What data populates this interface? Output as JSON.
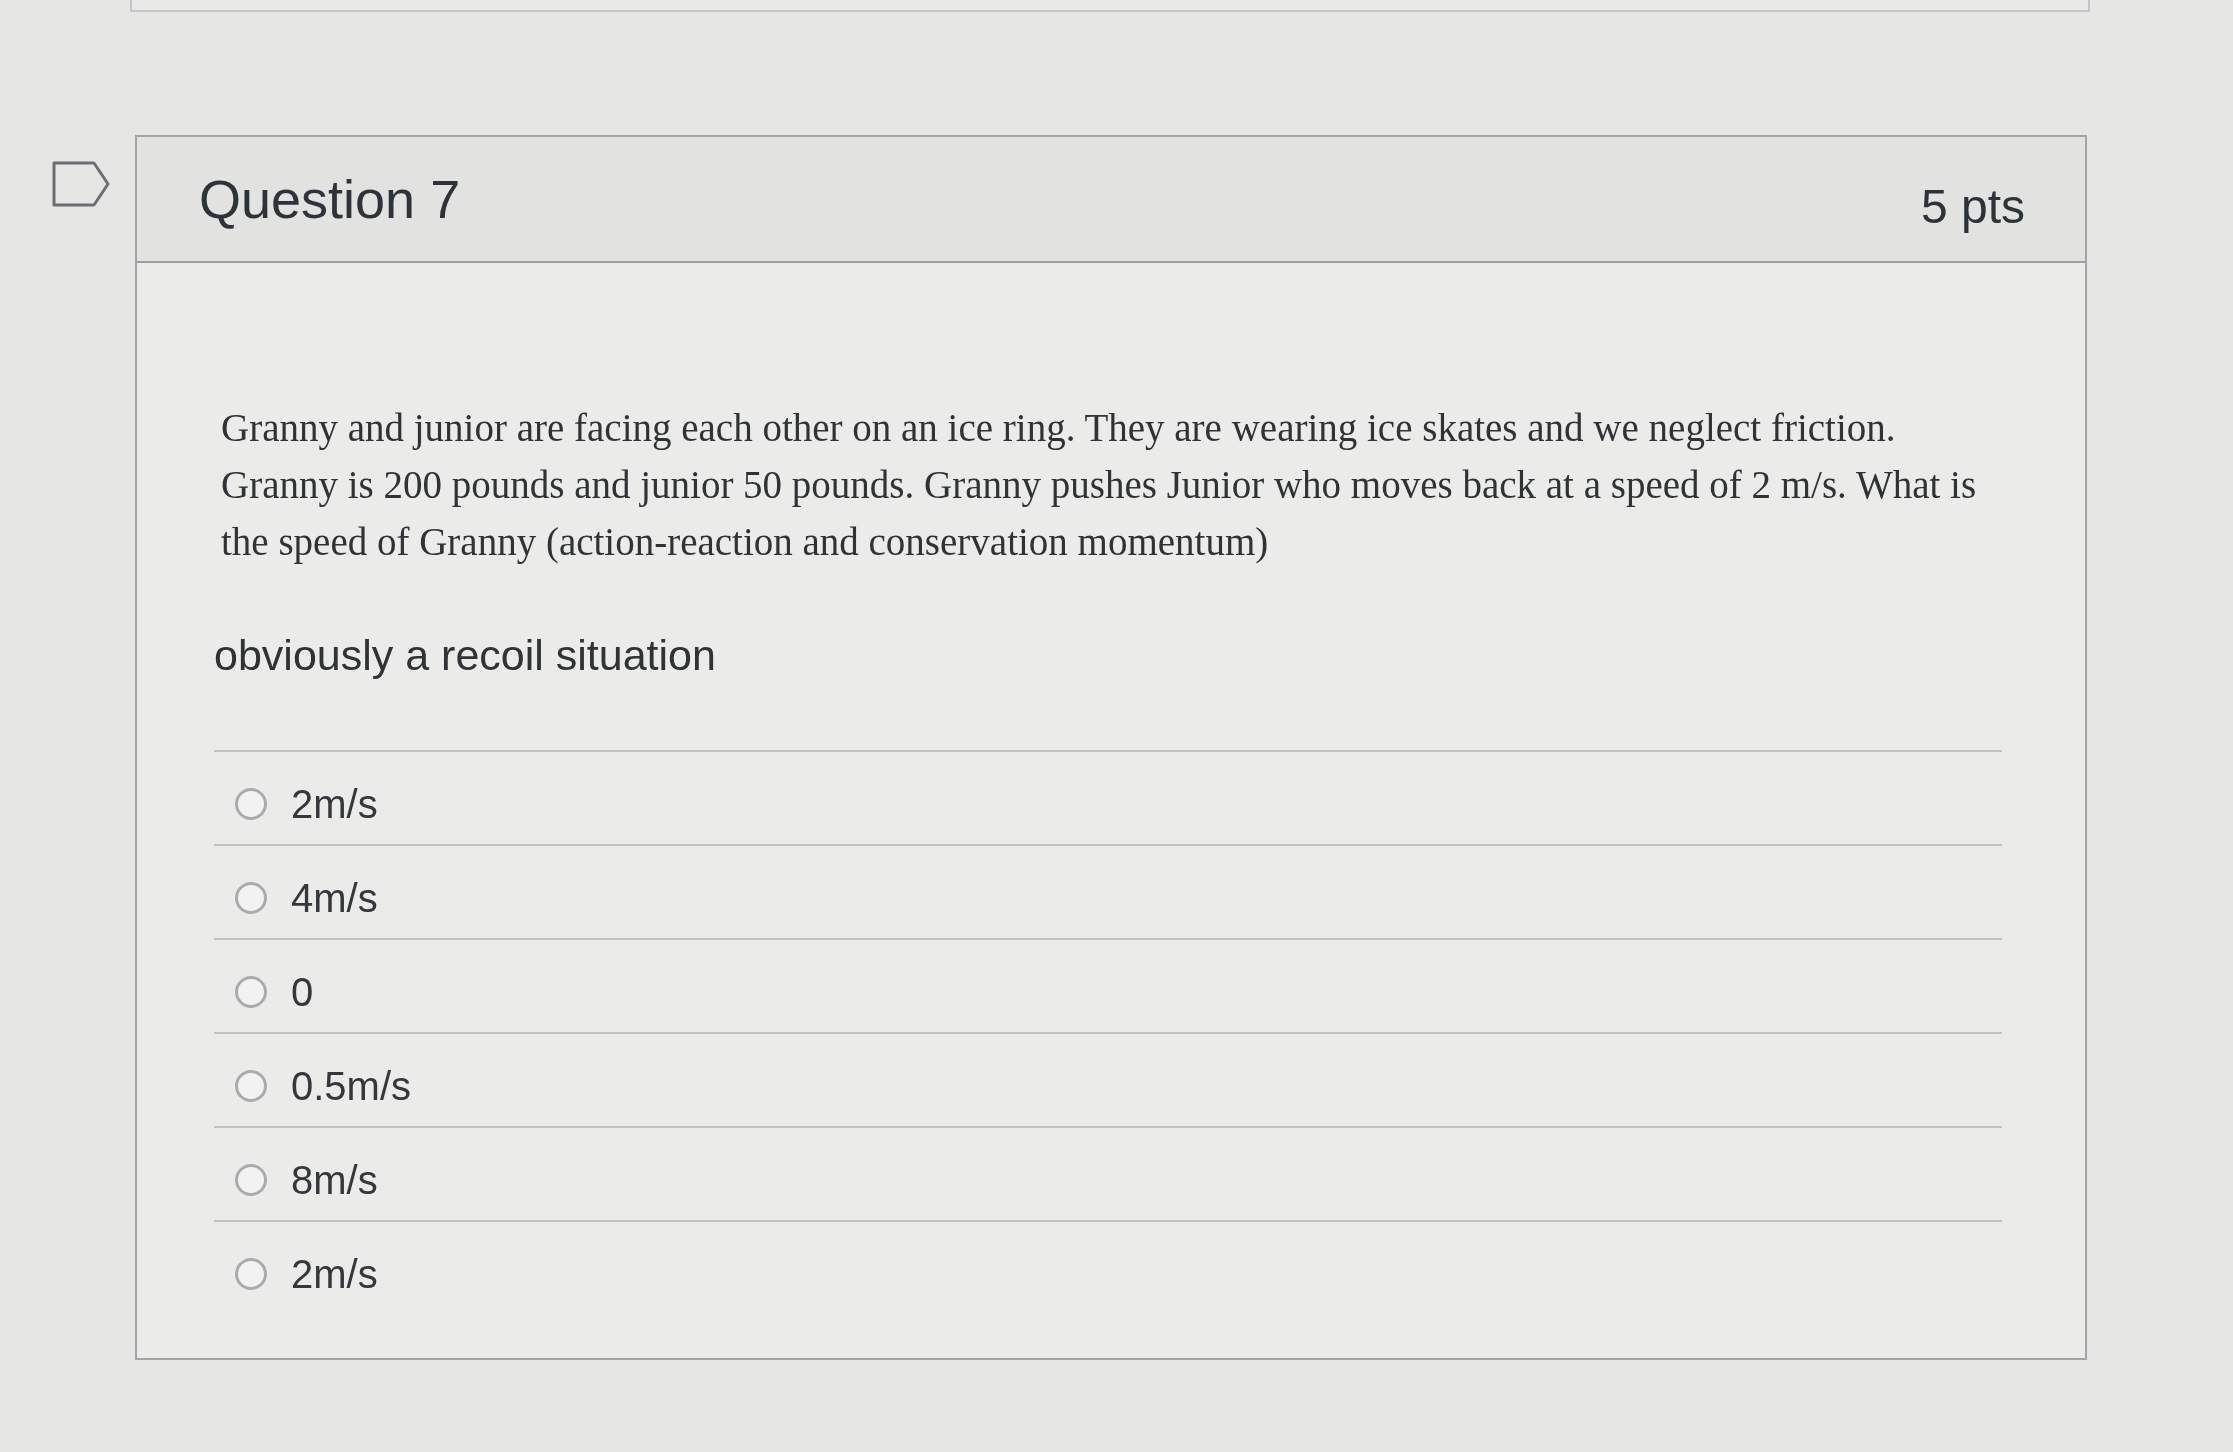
{
  "question": {
    "flagged": false,
    "title": "Question 7",
    "points": "5 pts",
    "text": "Granny and junior are facing each other on an ice ring. They are wearing ice skates and we neglect friction. Granny is 200 pounds and junior 50 pounds. Granny pushes Junior who moves back at a speed of 2 m/s. What is the speed of Granny (action-reaction and conservation momentum)",
    "note": "obviously a recoil situation",
    "answers": [
      {
        "label": "2m/s",
        "selected": false
      },
      {
        "label": "4m/s",
        "selected": false
      },
      {
        "label": "0",
        "selected": false
      },
      {
        "label": "0.5m/s",
        "selected": false
      },
      {
        "label": "8m/s",
        "selected": false
      },
      {
        "label": "2m/s",
        "selected": false
      }
    ]
  }
}
